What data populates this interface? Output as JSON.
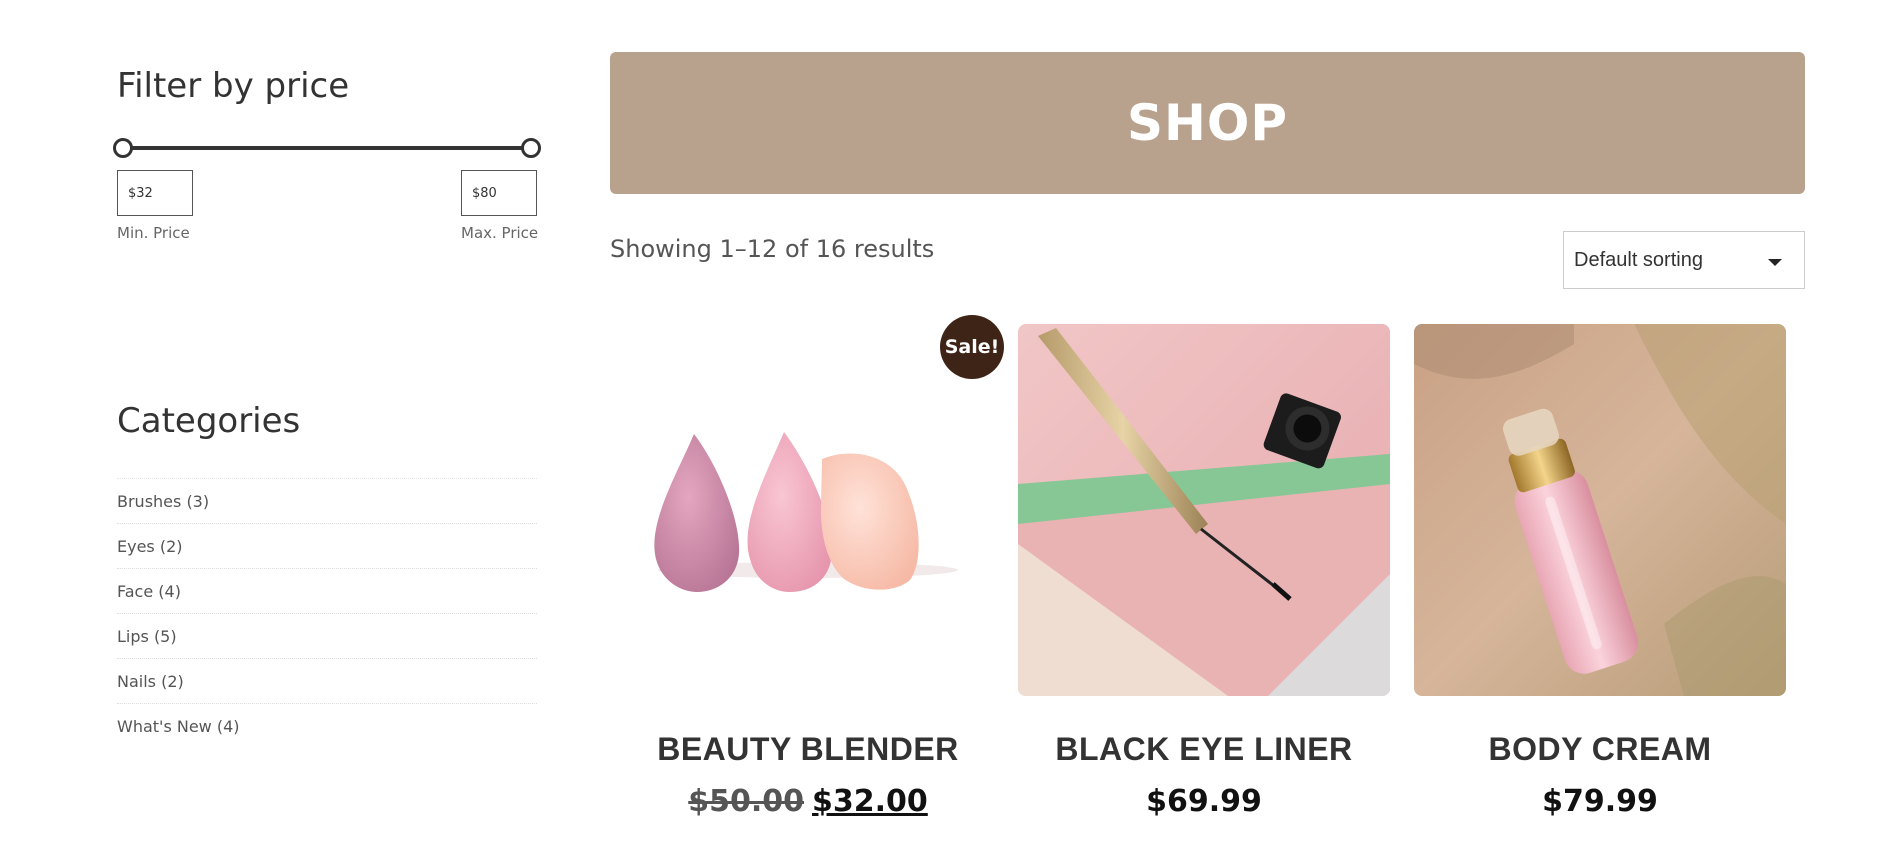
{
  "filter": {
    "title": "Filter by price",
    "min_value": "$32",
    "max_value": "$80",
    "min_label": "Min. Price",
    "max_label": "Max. Price"
  },
  "categories": {
    "title": "Categories",
    "items": [
      {
        "label": "Brushes (3)"
      },
      {
        "label": "Eyes (2)"
      },
      {
        "label": "Face (4)"
      },
      {
        "label": "Lips (5)"
      },
      {
        "label": "Nails (2)"
      },
      {
        "label": "What's New (4)"
      }
    ]
  },
  "shop": {
    "title": "SHOP",
    "result_count": "Showing 1–12 of 16 results",
    "sort_selected": "Default sorting"
  },
  "products": [
    {
      "name": "BEAUTY BLENDER",
      "old_price": "$50.00",
      "price": "$32.00",
      "badge": "Sale!",
      "image_icon": "beauty-blender-image"
    },
    {
      "name": "BLACK EYE LINER",
      "price": "$69.99",
      "image_icon": "eye-liner-image"
    },
    {
      "name": "BODY CREAM",
      "price": "$79.99",
      "image_icon": "body-cream-image"
    }
  ],
  "colors": {
    "banner": "#b8a18d",
    "badge": "#3e2416",
    "text": "#333333"
  }
}
